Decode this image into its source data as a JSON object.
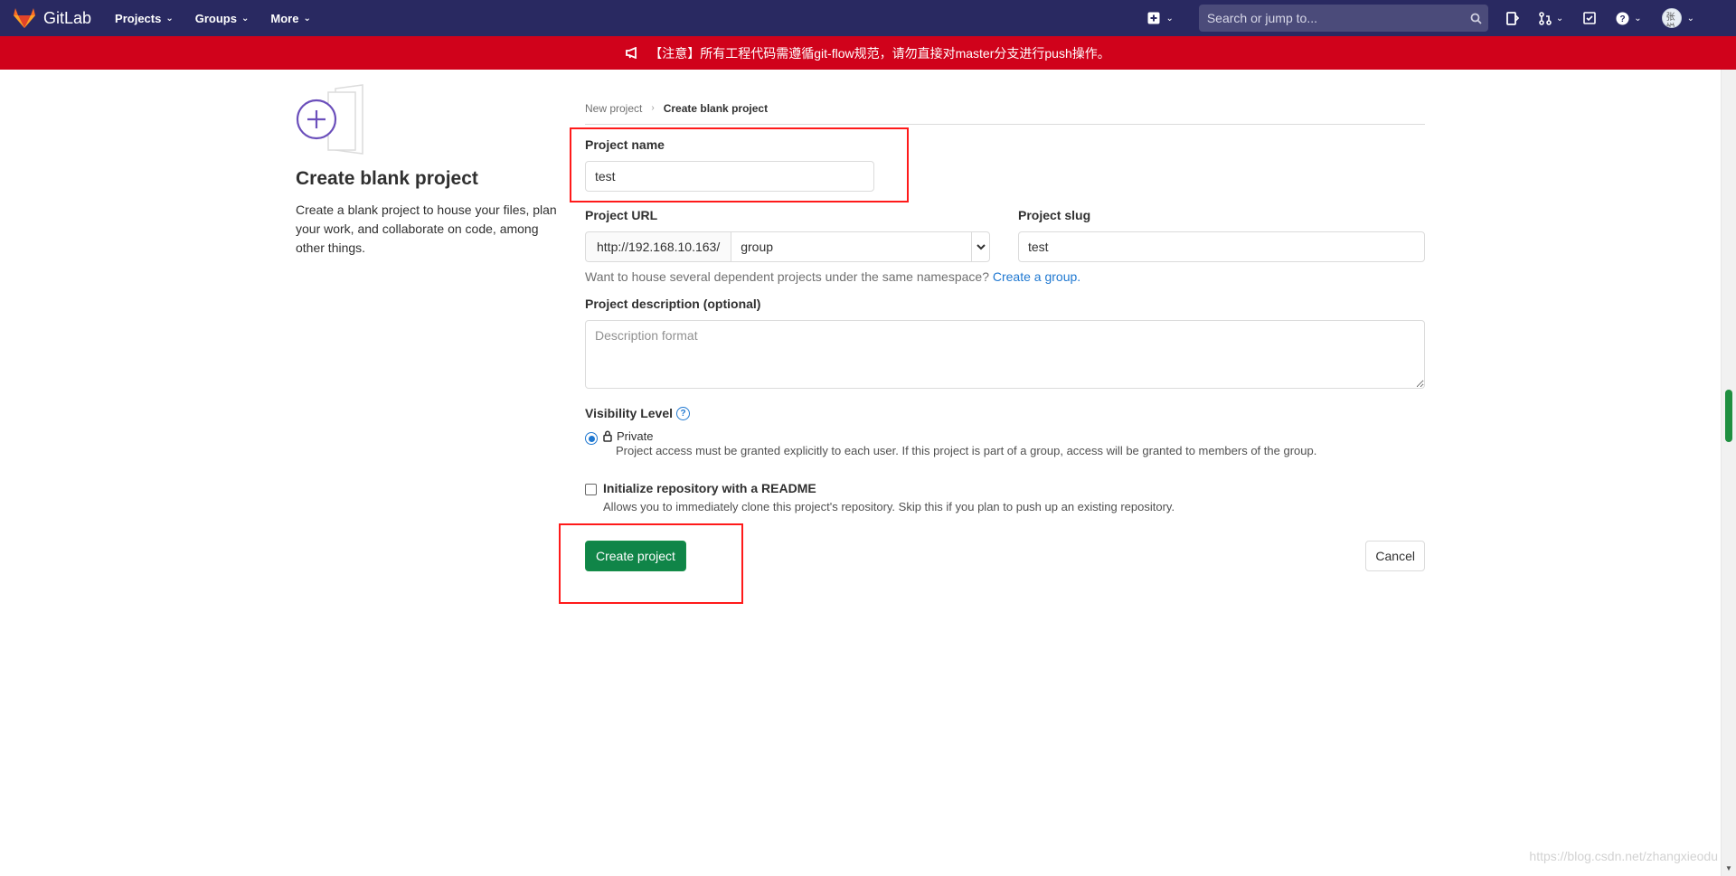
{
  "navbar": {
    "brand": "GitLab",
    "menu": [
      {
        "label": "Projects"
      },
      {
        "label": "Groups"
      },
      {
        "label": "More"
      }
    ],
    "search_placeholder": "Search or jump to...",
    "user_name": "张悦"
  },
  "banner": {
    "text": "【注意】所有工程代码需遵循git-flow规范，请勿直接对master分支进行push操作。"
  },
  "left": {
    "title": "Create blank project",
    "description": "Create a blank project to house your files, plan your work, and collaborate on code, among other things."
  },
  "breadcrumb": {
    "parent": "New project",
    "current": "Create blank project"
  },
  "form": {
    "project_name_label": "Project name",
    "project_name_value": "test",
    "project_url_label": "Project URL",
    "project_url_prefix": "http://192.168.10.163/",
    "namespace_value": "group",
    "project_slug_label": "Project slug",
    "project_slug_value": "test",
    "namespace_help": "Want to house several dependent projects under the same namespace?",
    "namespace_help_link": "Create a group.",
    "description_label": "Project description (optional)",
    "description_placeholder": "Description format",
    "visibility_label": "Visibility Level",
    "visibility_option": "Private",
    "visibility_option_desc": "Project access must be granted explicitly to each user. If this project is part of a group, access will be granted to members of the group.",
    "readme_label": "Initialize repository with a README",
    "readme_desc": "Allows you to immediately clone this project's repository. Skip this if you plan to push up an existing repository.",
    "create_button": "Create project",
    "cancel_button": "Cancel"
  },
  "watermark": "https://blog.csdn.net/zhangxieodu",
  "colors": {
    "navbar": "#292961",
    "banner": "#d0021b",
    "create_button": "#108548",
    "link": "#1f78d1",
    "annotation": "#ff1a1a"
  }
}
